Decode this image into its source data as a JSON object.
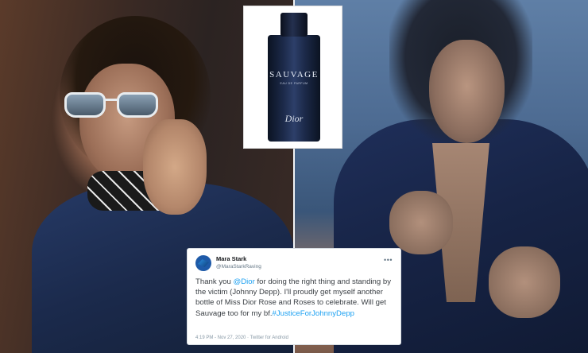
{
  "perfume": {
    "name": "SAUVAGE",
    "sub": "EAU DE PARFUM",
    "brand": "Dior"
  },
  "tweet": {
    "name": "Mara Stark",
    "handle": "@MaraStarkRaving",
    "text_1": "Thank you ",
    "mention": "@Dior",
    "text_2": " for doing the right thing and standing by the victim (Johnny Depp). I'll proudly get myself another bottle of Miss Dior Rose and Roses to celebrate. Will get Sauvage too for my bf.",
    "hashtag": "#JusticeForJohnnyDepp",
    "footer": "4:19 PM - Nov 27, 2020 · Twitter for Android",
    "more": "•••"
  }
}
